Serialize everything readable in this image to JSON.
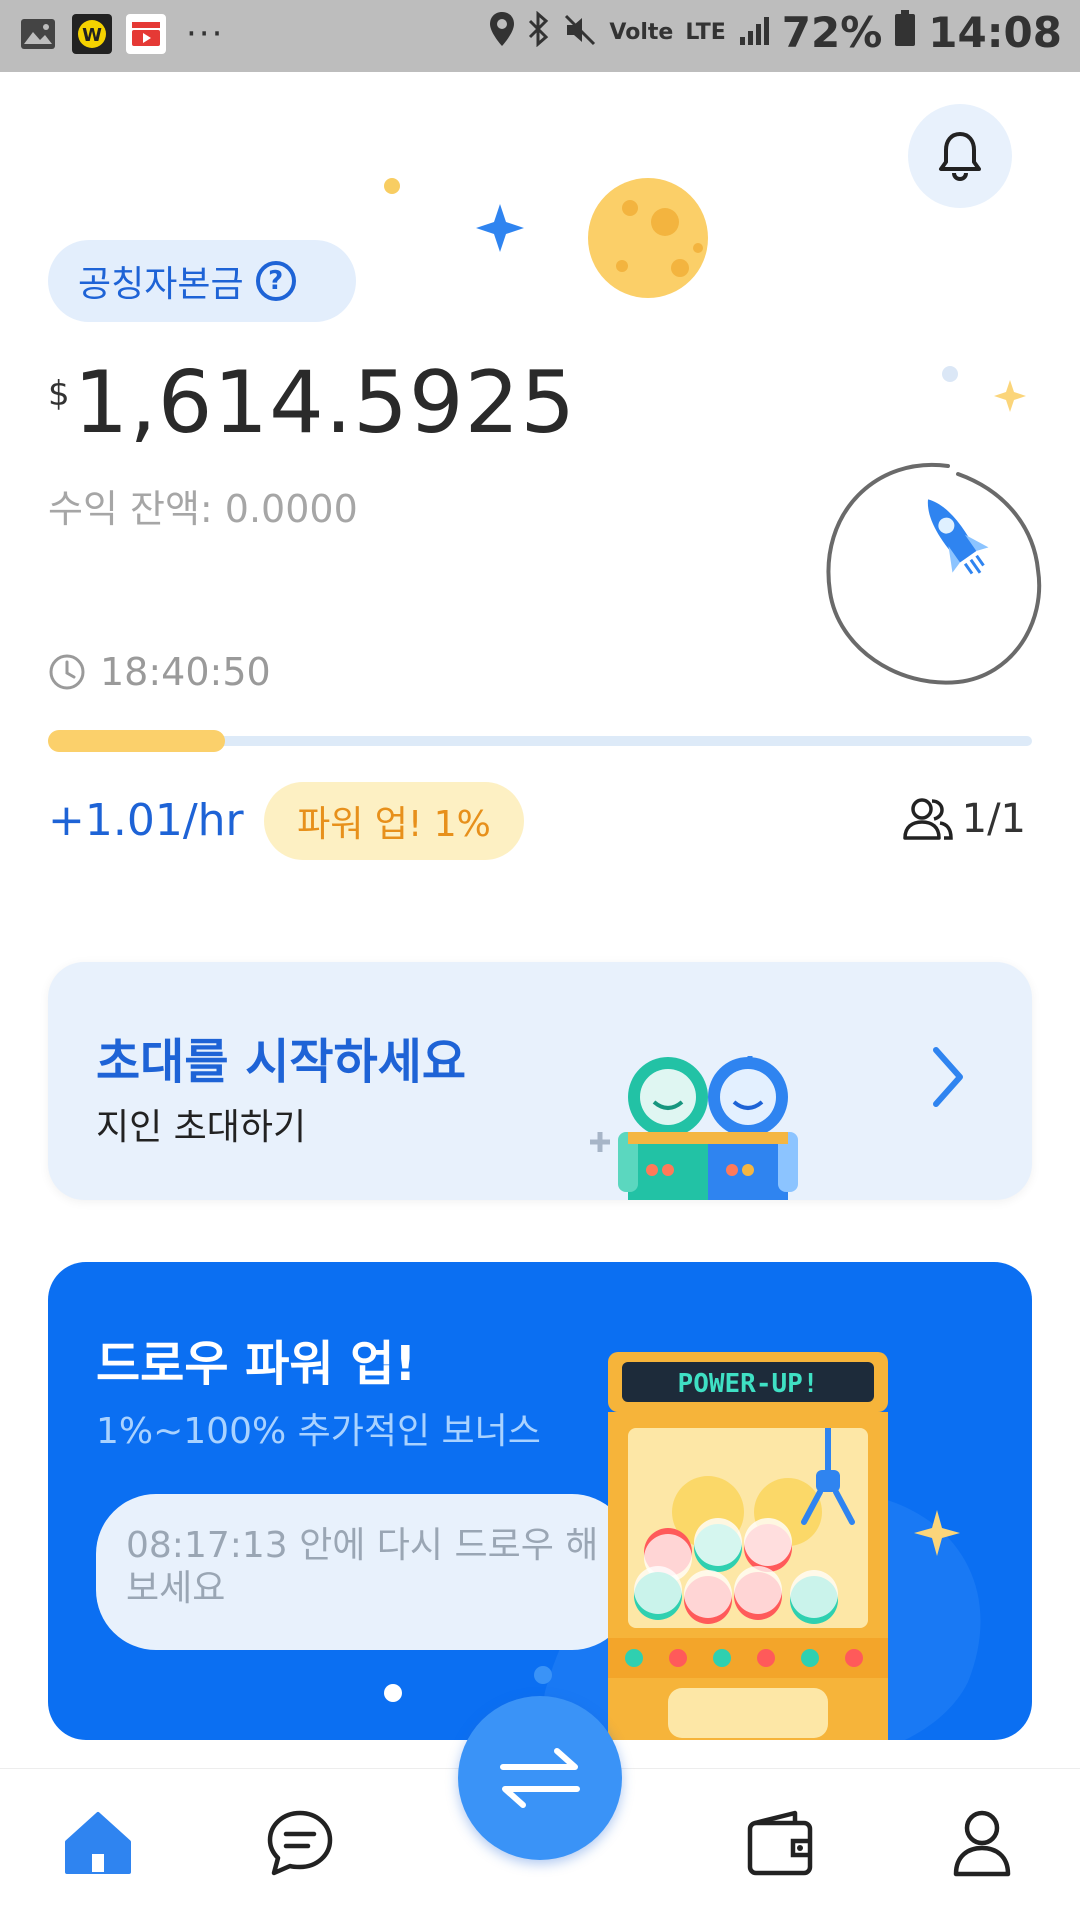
{
  "status_bar": {
    "battery": "72%",
    "time": "14:08",
    "volte": "Volte",
    "lte": "LTE"
  },
  "fund": {
    "chip_label": "공칭자본금",
    "currency": "$",
    "amount": "1,614.5925",
    "income_balance": "수익 잔액: 0.0000",
    "timer": "18:40:50",
    "progress": 0.18,
    "rate": "+1.01/hr",
    "power_up": "파워 업! 1%",
    "members": "1/1"
  },
  "invite": {
    "title": "초대를 시작하세요",
    "subtitle": "지인 초대하기"
  },
  "draw_banner": {
    "title": "드로우 파워 업!",
    "subtitle": "1%~100% 추가적인 보너스",
    "countdown": "08:17:13 안에 다시 드로우 해 보세요",
    "machine_sign": "POWER-UP!"
  },
  "nav": {
    "active": "home",
    "items": [
      "home",
      "chat",
      "swap",
      "wallet",
      "profile"
    ]
  },
  "colors": {
    "primary": "#1e63d6",
    "banner_blue": "#0b6ff2",
    "progress_yellow": "#fbd06b",
    "power_orange": "#e7901b"
  }
}
